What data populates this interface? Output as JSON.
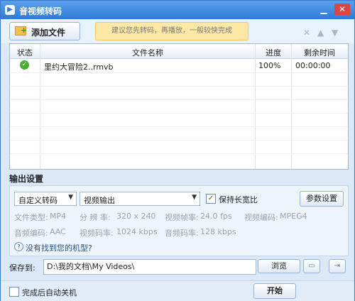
{
  "window": {
    "title": "音视频转码"
  },
  "toolbar": {
    "add_file_label": "添加文件",
    "notice_text": "建议您先转码，再播放，一般较快完成"
  },
  "table": {
    "columns": [
      "状态",
      "文件名称",
      "进度",
      "剩余时间"
    ],
    "rows": [
      {
        "status": "done",
        "name": "里约大冒险2..rmvb",
        "progress": "100%",
        "remaining": "00:00:00"
      }
    ]
  },
  "output": {
    "section_title": "输出设置",
    "preset": "自定义转码",
    "format": "视频输出",
    "keep_ratio_label": "保持长宽比",
    "keep_ratio_checked": true,
    "params_button": "参数设置",
    "file_type_label": "文件类型:",
    "file_type": "MP4",
    "resolution_label": "分 辨 率:",
    "resolution": "320 x 240",
    "frame_rate_label": "视频帧率:",
    "frame_rate": "24.0 fps",
    "video_codec_label": "视频编码:",
    "video_codec": "MPEG4",
    "audio_codec_label": "音频编码:",
    "audio_codec": "AAC",
    "video_bitrate_label": "视频码率:",
    "video_bitrate": "1024 kbps",
    "audio_bitrate_label": "音频码率:",
    "audio_bitrate": "128 kbps",
    "help_text": "没有找到您的机型?"
  },
  "save": {
    "label": "保存到:",
    "path": "D:\\我的文档\\My Videos\\",
    "browse_label": "浏览"
  },
  "footer": {
    "auto_shutdown_label": "完成后自动关机",
    "start_label": "开始"
  }
}
